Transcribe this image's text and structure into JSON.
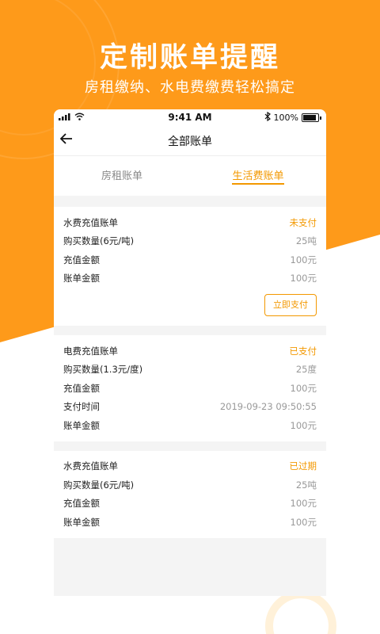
{
  "colors": {
    "accent": "#f39800",
    "background_orange": "#fe9a1a"
  },
  "hero": {
    "title": "定制账单提醒",
    "subtitle": "房租缴纳、水电费缴费轻松搞定"
  },
  "status_bar": {
    "time": "9:41 AM",
    "battery": "100%",
    "icons": [
      "signal-icon",
      "wifi-icon",
      "bluetooth-icon",
      "battery-icon"
    ]
  },
  "nav": {
    "title": "全部账单",
    "back_icon": "back-arrow-icon"
  },
  "tabs": [
    {
      "label": "房租账单",
      "active": false
    },
    {
      "label": "生活费账单",
      "active": true
    }
  ],
  "bills": [
    {
      "title": "水费充值账单",
      "status": "未支付",
      "rows": [
        {
          "label": "购买数量(6元/吨)",
          "value": "25吨"
        },
        {
          "label": "充值金额",
          "value": "100元"
        },
        {
          "label": "账单金额",
          "value": "100元"
        }
      ],
      "action": "立即支付"
    },
    {
      "title": "电费充值账单",
      "status": "已支付",
      "rows": [
        {
          "label": "购买数量(1.3元/度)",
          "value": "25度"
        },
        {
          "label": "充值金额",
          "value": "100元"
        },
        {
          "label": "支付时间",
          "value": "2019-09-23 09:50:55"
        },
        {
          "label": "账单金额",
          "value": "100元"
        }
      ]
    },
    {
      "title": "水费充值账单",
      "status": "已过期",
      "rows": [
        {
          "label": "购买数量(6元/吨)",
          "value": "25吨"
        },
        {
          "label": "充值金额",
          "value": "100元"
        },
        {
          "label": "账单金额",
          "value": "100元"
        }
      ]
    }
  ]
}
